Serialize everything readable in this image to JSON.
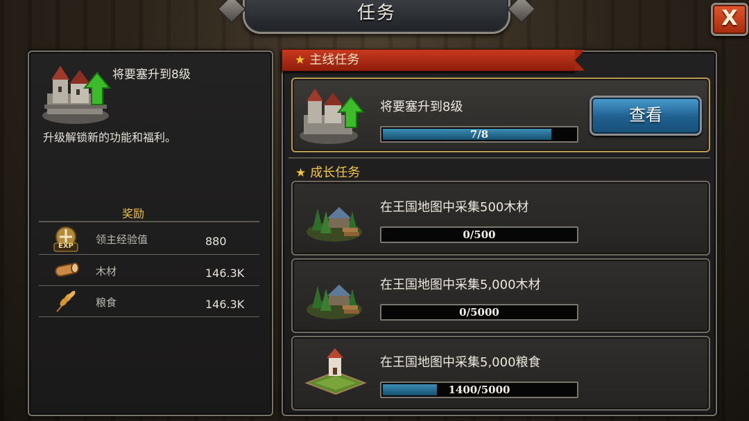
{
  "header": {
    "title": "任务",
    "close_label": "X"
  },
  "detail": {
    "title": "将要塞升到8级",
    "description": "升级解锁新的功能和福利。",
    "rewards_title": "奖励",
    "rewards": [
      {
        "icon": "exp-icon",
        "badge": "EXP",
        "name": "领主经验值",
        "value": "880"
      },
      {
        "icon": "wood-icon",
        "name": "木材",
        "value": "146.3K"
      },
      {
        "icon": "grain-icon",
        "name": "粮食",
        "value": "146.3K"
      }
    ]
  },
  "main_quest": {
    "section_title": "主线任务",
    "icon": "fortress-upgrade-icon",
    "name": "将要塞升到8级",
    "progress_text": "7/8",
    "progress": 0.875,
    "button_label": "查看"
  },
  "growth_quests": {
    "section_title": "成长任务",
    "items": [
      {
        "icon": "lumber-camp-icon",
        "name": "在王国地图中采集500木材",
        "progress_text": "0/500",
        "progress": 0
      },
      {
        "icon": "lumber-camp-icon",
        "name": "在王国地图中采集5,000木材",
        "progress_text": "0/5000",
        "progress": 0
      },
      {
        "icon": "farm-icon",
        "name": "在王国地图中采集5,000粮食",
        "progress_text": "1400/5000",
        "progress": 0.28
      }
    ]
  },
  "colors": {
    "accent_gold": "#f2c043",
    "banner_red": "#b7321a",
    "button_blue": "#2f7fb3",
    "progress_blue": "#2a7aa3"
  }
}
